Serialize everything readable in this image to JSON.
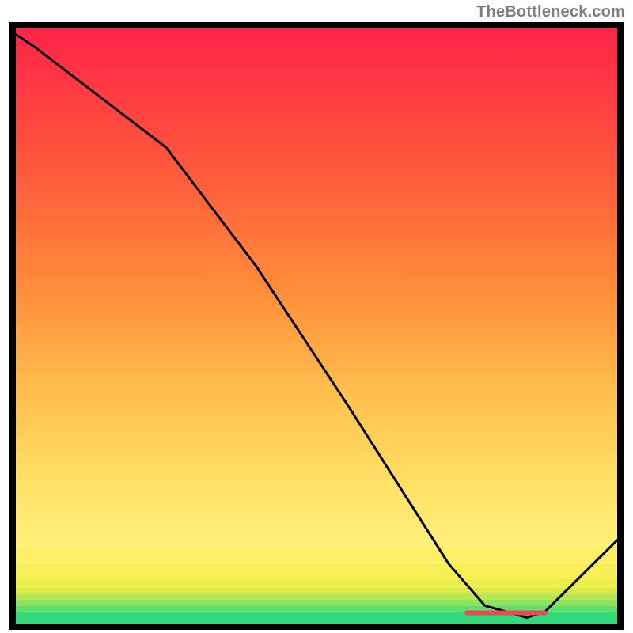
{
  "attribution": "TheBottleneck.com",
  "chart_data": {
    "type": "line",
    "title": "",
    "xlabel": "",
    "ylabel": "",
    "legend": false,
    "grid": false,
    "xlim": [
      0,
      100
    ],
    "ylim": [
      0,
      100
    ],
    "x": [
      0,
      3,
      25,
      40,
      55,
      72,
      78,
      85,
      88,
      100
    ],
    "bottleneck": [
      99,
      97,
      80,
      60,
      37,
      10,
      3,
      1,
      2,
      14
    ],
    "optimum_marker": {
      "x_start": 75,
      "x_end": 88,
      "y": 1.8
    },
    "background_bands": [
      {
        "from_y": 0,
        "to_y": 2.0,
        "color": "#36d97a"
      },
      {
        "from_y": 2.0,
        "to_y": 3.0,
        "color": "#62de6f"
      },
      {
        "from_y": 3.0,
        "to_y": 4.0,
        "color": "#8ee35f"
      },
      {
        "from_y": 4.0,
        "to_y": 5.0,
        "color": "#b6e751"
      },
      {
        "from_y": 5.0,
        "to_y": 6.0,
        "color": "#d7ea4a"
      },
      {
        "from_y": 6.0,
        "to_y": 7.5,
        "color": "#eded4b"
      },
      {
        "from_y": 7.5,
        "to_y": 10,
        "color": "#f6ef56"
      },
      {
        "from_y": 10,
        "to_y": 13,
        "color": "#fdf067"
      },
      {
        "from_y": 13,
        "to_y": 100,
        "gradient": true
      }
    ]
  }
}
